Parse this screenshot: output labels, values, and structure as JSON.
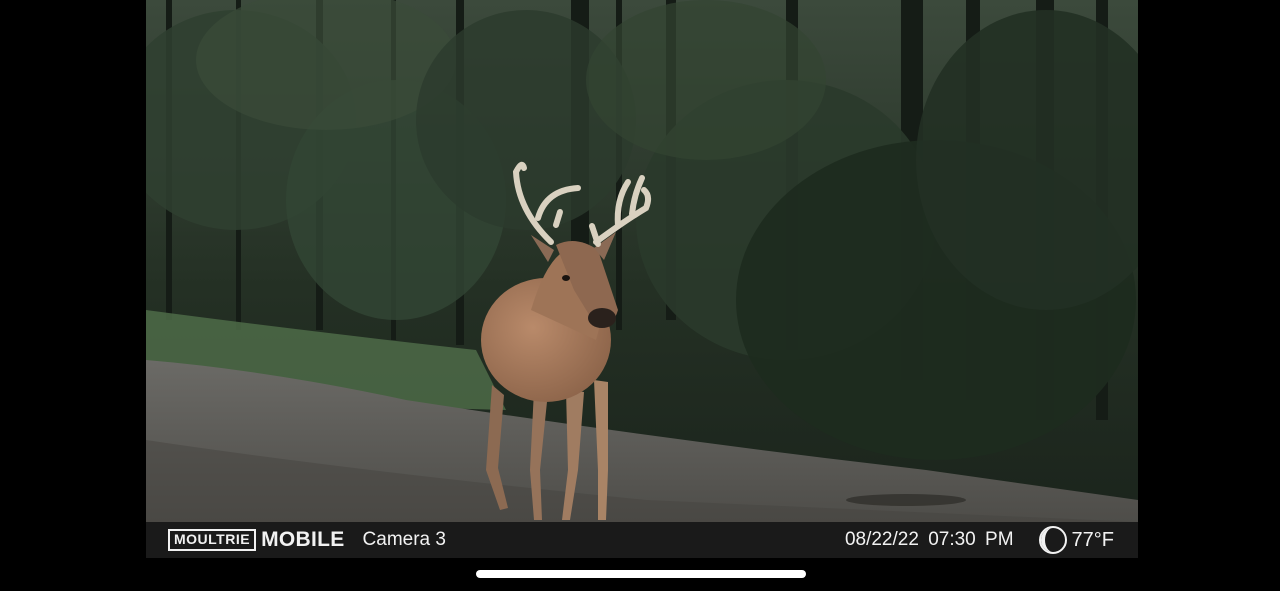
{
  "overlay": {
    "brand_box": "MOULTRIE",
    "brand_word": "MOBILE",
    "camera_name": "Camera 3",
    "date": "08/22/22",
    "time": "07:30 PM",
    "moon_icon": "waning-crescent-moon-icon",
    "temperature": "77°F"
  },
  "photo": {
    "subject": "buck"
  },
  "colors": {
    "background": "#000000",
    "info_bar": "#1a1a1a",
    "text": "#f2f2f2"
  }
}
